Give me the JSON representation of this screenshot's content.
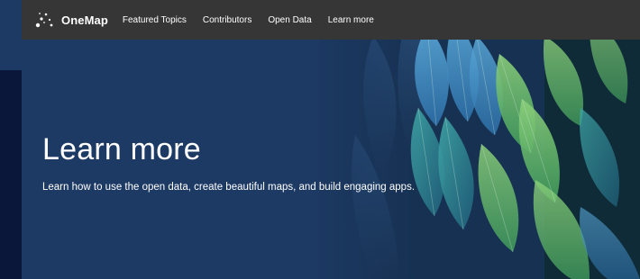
{
  "brand": {
    "name": "OneMap",
    "icon": "constellation-logo-icon"
  },
  "nav": {
    "items": [
      {
        "label": "Featured Topics"
      },
      {
        "label": "Contributors"
      },
      {
        "label": "Open Data"
      },
      {
        "label": "Learn more"
      }
    ]
  },
  "hero": {
    "title": "Learn more",
    "subtitle": "Learn how to use the open data, create beautiful maps, and build engaging apps.",
    "image": "feathers-background"
  },
  "colors": {
    "navbar": "#363636",
    "hero_background": "#1d3a64",
    "page_background": "#0a173a",
    "text": "#ffffff"
  }
}
